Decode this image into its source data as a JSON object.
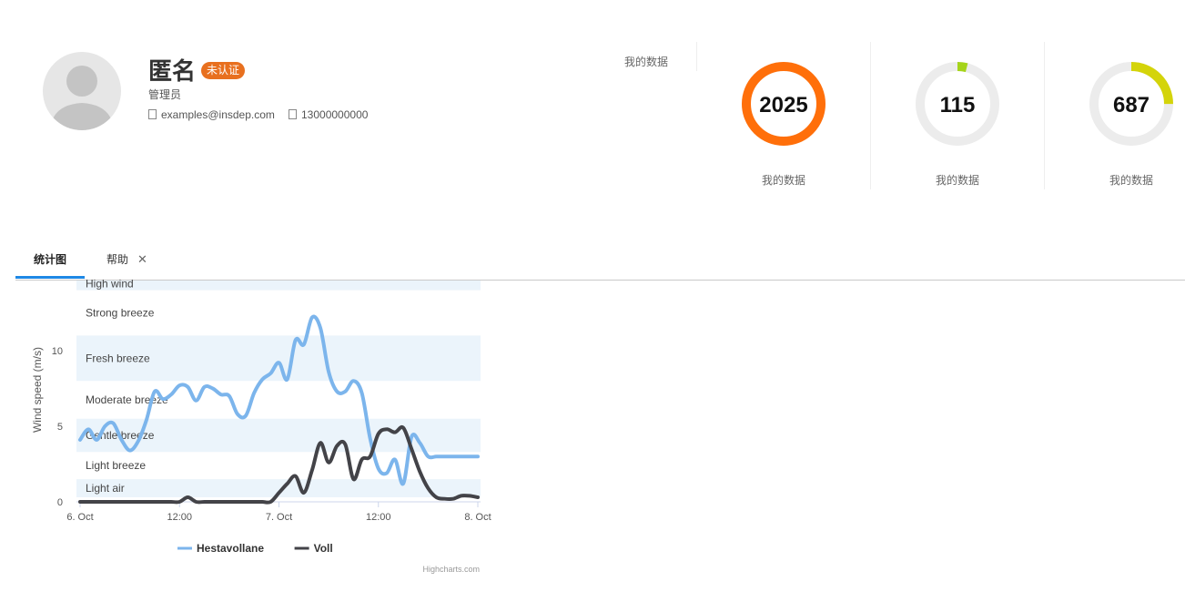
{
  "profile": {
    "name": "匿名",
    "badge": "未认证",
    "role": "管理员",
    "email": "examples@insdep.com",
    "phone": "13000000000"
  },
  "stats": {
    "header_label": "我的数据",
    "items": [
      {
        "value": "2025",
        "caption": "我的数据",
        "fraction": 1.0,
        "color": "#ff6f0a"
      },
      {
        "value": "115",
        "caption": "我的数据",
        "fraction": 0.04,
        "color": "#a5d41a"
      },
      {
        "value": "687",
        "caption": "我的数据",
        "fraction": 0.25,
        "color": "#d4d40a"
      }
    ]
  },
  "tabs": [
    {
      "label": "统计图",
      "active": true
    },
    {
      "label": "帮助",
      "active": false,
      "closable": true
    }
  ],
  "chart_data": {
    "type": "line",
    "title": "",
    "ylabel": "Wind speed (m/s)",
    "xlabel": "",
    "ylim": [
      0,
      14
    ],
    "xlim_hours": [
      0,
      48
    ],
    "x_tick_labels": [
      "6. Oct",
      "12:00",
      "7. Oct",
      "12:00",
      "8. Oct"
    ],
    "x_tick_hours": [
      0,
      12,
      24,
      36,
      48
    ],
    "y_ticks": [
      0,
      5,
      10
    ],
    "bands": [
      {
        "label": "Light air",
        "from": 0.3,
        "to": 1.5,
        "shaded": true
      },
      {
        "label": "Light breeze",
        "from": 1.5,
        "to": 3.3,
        "shaded": false
      },
      {
        "label": "Gentle breeze",
        "from": 3.3,
        "to": 5.5,
        "shaded": true
      },
      {
        "label": "Moderate breeze",
        "from": 5.5,
        "to": 8,
        "shaded": false
      },
      {
        "label": "Fresh breeze",
        "from": 8,
        "to": 11,
        "shaded": true
      },
      {
        "label": "Strong breeze",
        "from": 11,
        "to": 14,
        "shaded": false
      },
      {
        "label": "High wind",
        "from": 14,
        "to": 15,
        "shaded": true
      }
    ],
    "series": [
      {
        "name": "Hestavollane",
        "color": "#7cb5ec",
        "x_hours": [
          0,
          1,
          2,
          3,
          4,
          5,
          6,
          7,
          8,
          9,
          10,
          11,
          12,
          13,
          14,
          15,
          16,
          17,
          18,
          19,
          20,
          21,
          22,
          23,
          24,
          25,
          26,
          27,
          28,
          29,
          30,
          31,
          32,
          33,
          34,
          35,
          36,
          37,
          38,
          39,
          40,
          41,
          42,
          43,
          44,
          45,
          46,
          47,
          48
        ],
        "values": [
          4.1,
          4.8,
          4.1,
          5.0,
          5.2,
          4.1,
          3.4,
          4.0,
          5.4,
          7.3,
          6.8,
          7.1,
          7.7,
          7.6,
          6.7,
          7.6,
          7.5,
          7.1,
          7.0,
          5.8,
          5.7,
          7.2,
          8.1,
          8.5,
          9.2,
          8.1,
          10.7,
          10.4,
          12.2,
          11.5,
          8.6,
          7.3,
          7.3,
          8.0,
          7.2,
          4.2,
          2.2,
          1.9,
          2.8,
          1.2,
          4.3,
          3.9,
          3.0,
          3.0,
          3.0,
          3.0,
          3.0,
          3.0,
          3.0
        ]
      },
      {
        "name": "Voll",
        "color": "#434348",
        "x_hours": [
          0,
          1,
          2,
          3,
          4,
          5,
          6,
          7,
          8,
          9,
          10,
          11,
          12,
          13,
          14,
          15,
          16,
          17,
          18,
          19,
          20,
          21,
          22,
          23,
          24,
          25,
          26,
          27,
          28,
          29,
          30,
          31,
          32,
          33,
          34,
          35,
          36,
          37,
          38,
          39,
          40,
          41,
          42,
          43,
          44,
          45,
          46,
          47,
          48
        ],
        "values": [
          0,
          0,
          0,
          0,
          0,
          0,
          0,
          0,
          0,
          0,
          0,
          0,
          0,
          0.3,
          0,
          0,
          0,
          0,
          0,
          0,
          0,
          0,
          0,
          0,
          0.6,
          1.2,
          1.7,
          0.6,
          2.1,
          3.9,
          2.6,
          3.7,
          3.8,
          1.5,
          2.8,
          3.0,
          4.5,
          4.8,
          4.6,
          4.9,
          3.5,
          2.0,
          0.9,
          0.3,
          0.2,
          0.2,
          0.4,
          0.4,
          0.3
        ]
      }
    ],
    "credit": "Highcharts.com",
    "legend_position": "bottom-center"
  }
}
